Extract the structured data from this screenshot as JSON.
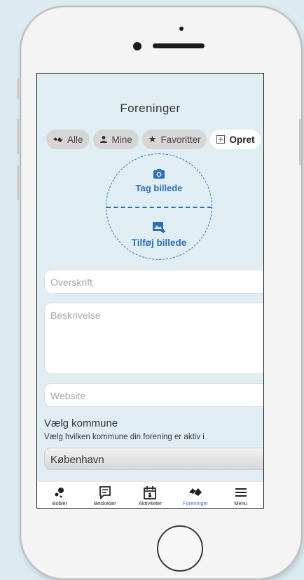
{
  "header": {
    "title": "Foreninger"
  },
  "tabs": [
    {
      "label": "Alle",
      "icon": "handshake-icon"
    },
    {
      "label": "Mine",
      "icon": "person-icon"
    },
    {
      "label": "Favoritter",
      "icon": "star-icon"
    },
    {
      "label": "Opret",
      "icon": "plus-square-icon",
      "active": true
    }
  ],
  "photo": {
    "take_label": "Tag billede",
    "add_label": "Tilføj billede"
  },
  "form": {
    "headline_placeholder": "Overskrift",
    "description_placeholder": "Beskrivelse",
    "website_placeholder": "Website",
    "municipality_label": "Vælg kommune",
    "municipality_help": "Vælg hvilken kommune din forening er aktiv i",
    "municipality_value": "København"
  },
  "nav": [
    {
      "label": "Bobler",
      "icon": "bubbles-icon"
    },
    {
      "label": "Beskeder",
      "icon": "message-icon"
    },
    {
      "label": "Aktiviteter",
      "icon": "calendar-icon"
    },
    {
      "label": "Foreninger",
      "icon": "handshake-icon",
      "active": true
    },
    {
      "label": "Menu",
      "icon": "menu-icon"
    }
  ],
  "colors": {
    "accent": "#2e6fb7",
    "background": "#e0eef4"
  }
}
